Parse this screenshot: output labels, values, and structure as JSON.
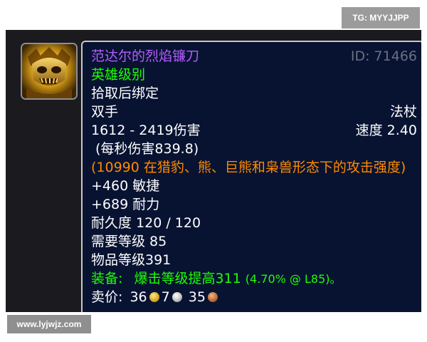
{
  "watermark_top": "TG: MYYJJPP",
  "watermark_bottom": "www.lyjwjz.com",
  "item": {
    "name": "范达尔的烈焰镰刀",
    "id_label": "ID: 71466",
    "quality": "英雄级别",
    "binding": "拾取后绑定",
    "slot": "双手",
    "type": "法杖",
    "damage": "1612 - 2419伤害",
    "speed": "速度 2.40",
    "dps": "(每秒伤害839.8)",
    "feral_ap": "(10990 在猎豹、熊、巨熊和枭兽形态下的攻击强度)",
    "agility": "+460 敏捷",
    "stamina": "+689 耐力",
    "durability": "耐久度 120 / 120",
    "required_level": "需要等级 85",
    "item_level": "物品等级391",
    "equip_prefix": "装备:",
    "equip_effect": "爆击等级提高311",
    "equip_detail": "(4.70% @ L85)。",
    "sell_label": "卖价:",
    "sell_gold": "36",
    "sell_silver": "7",
    "sell_copper": "35"
  },
  "icons": {
    "item_icon": "flaming-skull-icon",
    "gold": "gold-coin-icon",
    "silver": "silver-coin-icon",
    "copper": "copper-coin-icon"
  },
  "colors": {
    "panel_bg": "#1a1a1f",
    "tooltip_bg": "#081332",
    "epic_name": "#b35cff",
    "heroic_green": "#1eff00",
    "feral_orange": "#ff8a00"
  }
}
